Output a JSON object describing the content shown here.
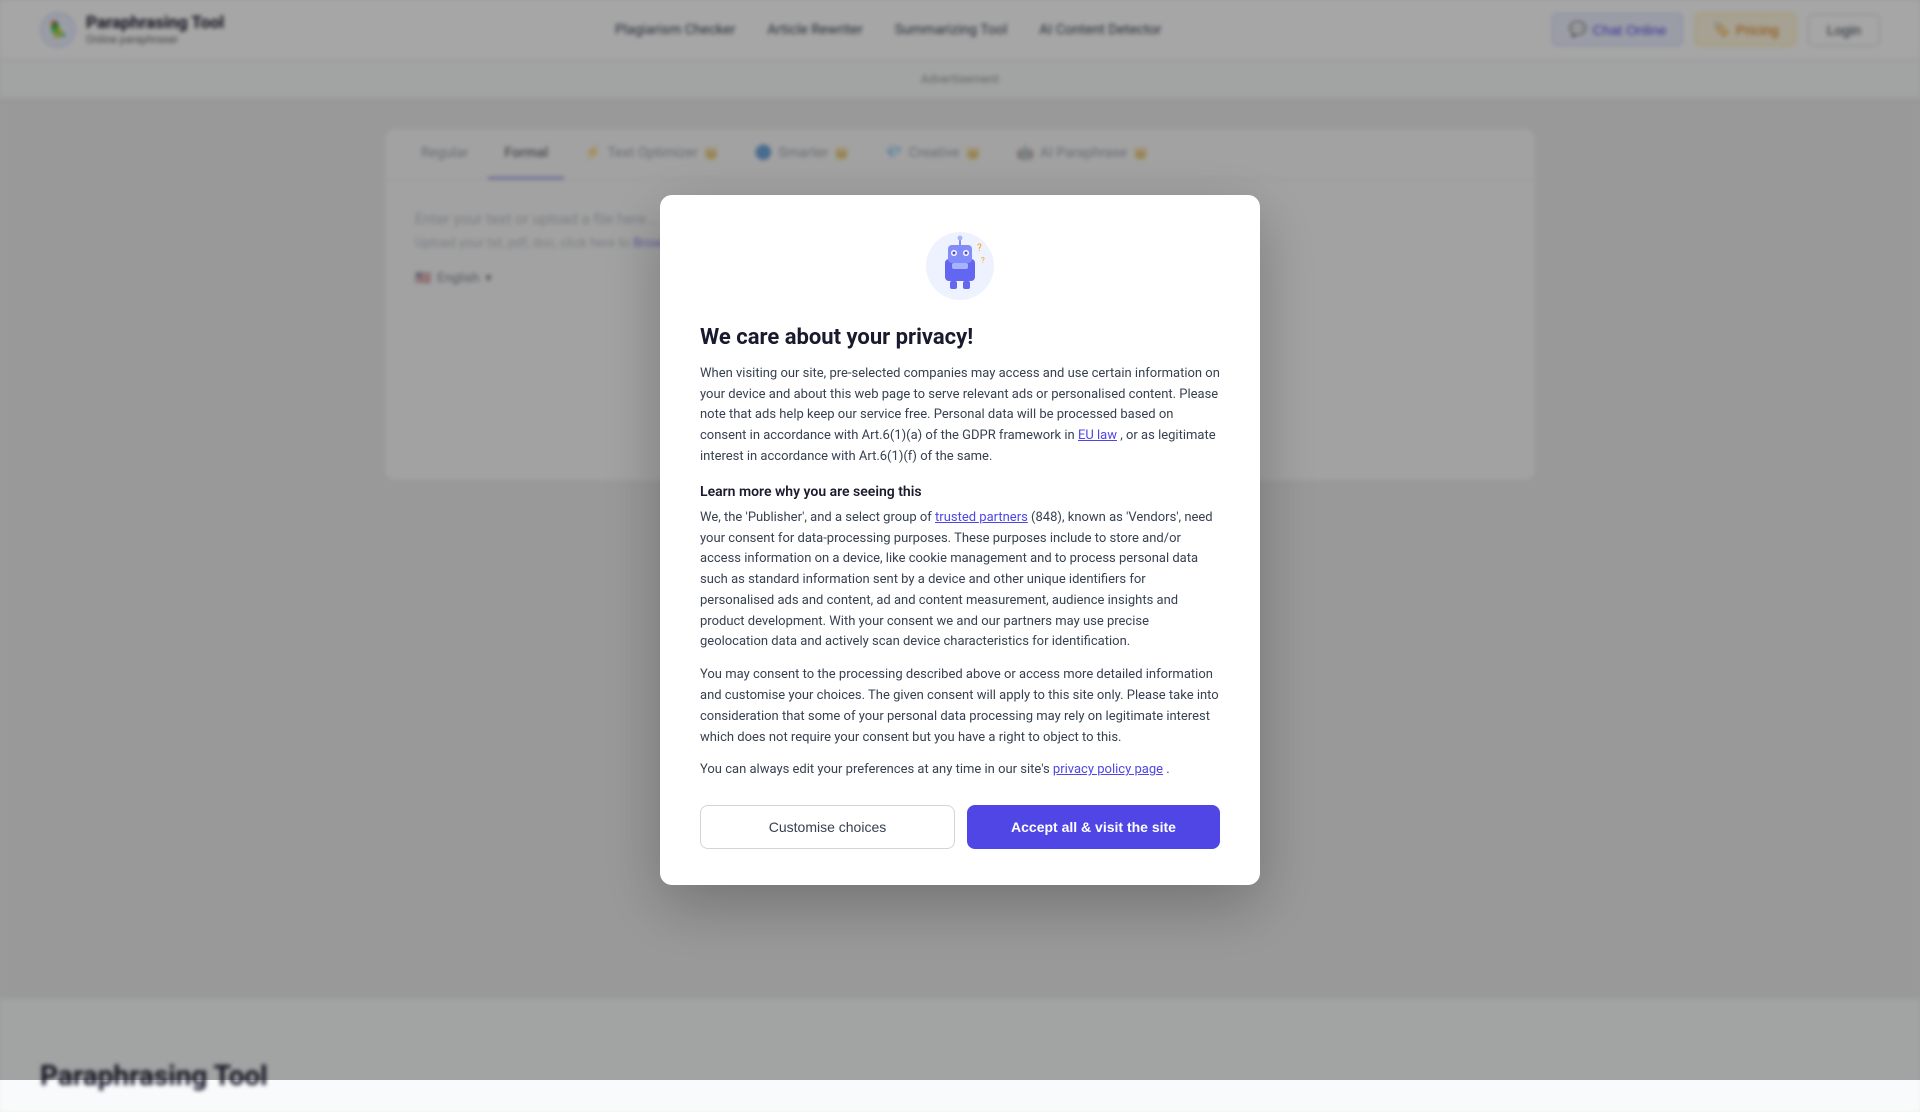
{
  "header": {
    "logo_title": "Paraphrasing Tool",
    "logo_subtitle": "Online paraphraser",
    "nav": [
      {
        "label": "Plagiarism Checker",
        "id": "plagiarism-checker"
      },
      {
        "label": "Article Rewriter",
        "id": "article-rewriter"
      },
      {
        "label": "Summarizing Tool",
        "id": "summarizing-tool"
      },
      {
        "label": "AI Content Detector",
        "id": "ai-content-detector"
      }
    ],
    "chat_online_label": "Chat Online",
    "pricing_label": "Pricing",
    "login_label": "Login"
  },
  "ad": {
    "label": "Advertisement"
  },
  "tabs": [
    {
      "label": "Regular",
      "id": "regular",
      "active": false,
      "icon": "",
      "crown": false
    },
    {
      "label": "Formal",
      "id": "formal",
      "active": true,
      "icon": "",
      "crown": false
    },
    {
      "label": "Text Optimizer",
      "id": "text-optimizer",
      "active": false,
      "icon": "⚡",
      "crown": true
    },
    {
      "label": "Smarter",
      "id": "smarter",
      "active": false,
      "icon": "🔵",
      "crown": true
    },
    {
      "label": "Creative",
      "id": "creative",
      "active": false,
      "icon": "💎",
      "crown": true
    },
    {
      "label": "AI Paraphrase",
      "id": "ai-paraphrase",
      "active": false,
      "icon": "🤖",
      "crown": true
    }
  ],
  "tool": {
    "placeholder": "Enter your text or upload a file here...",
    "upload_text": "Upload your txt, pdf, doc, click here to",
    "browse_label": "Browse files",
    "language": "English"
  },
  "modal": {
    "title": "We care about your privacy!",
    "body1": "When visiting our site, pre-selected companies may access and use certain information on your device and about this web page to serve relevant ads or personalised content. Please note that ads help keep our service free. Personal data will be processed based on consent in accordance with Art.6(1)(a) of the GDPR framework in",
    "eu_law_link": "EU law",
    "body1_cont": ", or as legitimate interest in accordance with Art.6(1)(f) of the same.",
    "learn_more_heading": "Learn more why you are seeing this",
    "body2_pre": "We, the 'Publisher', and a select group of",
    "trusted_partners_link": "trusted partners",
    "body2_mid": "(848), known as 'Vendors', need your consent for data-processing purposes. These purposes include to store and/or access information on a device, like cookie management and to process personal data such as standard information sent by a device and other unique identifiers for personalised ads and content, ad and content measurement, audience insights and product development. With your consent we and our partners may use precise geolocation data and actively scan device characteristics for identification.",
    "body3": "You may consent to the processing described above or access more detailed information and customise your choices. The given consent will apply to this site only. Please take into consideration that some of your personal data processing may rely on legitimate interest which does not require your consent but you have a right to object to this.",
    "body4_pre": "You can always edit your preferences at any time in our site's",
    "privacy_policy_link": "privacy policy page",
    "body4_end": ".",
    "customise_label": "Customise choices",
    "accept_label": "Accept all & visit the site"
  },
  "bottom": {
    "title": "Paraphrasing Tool"
  }
}
